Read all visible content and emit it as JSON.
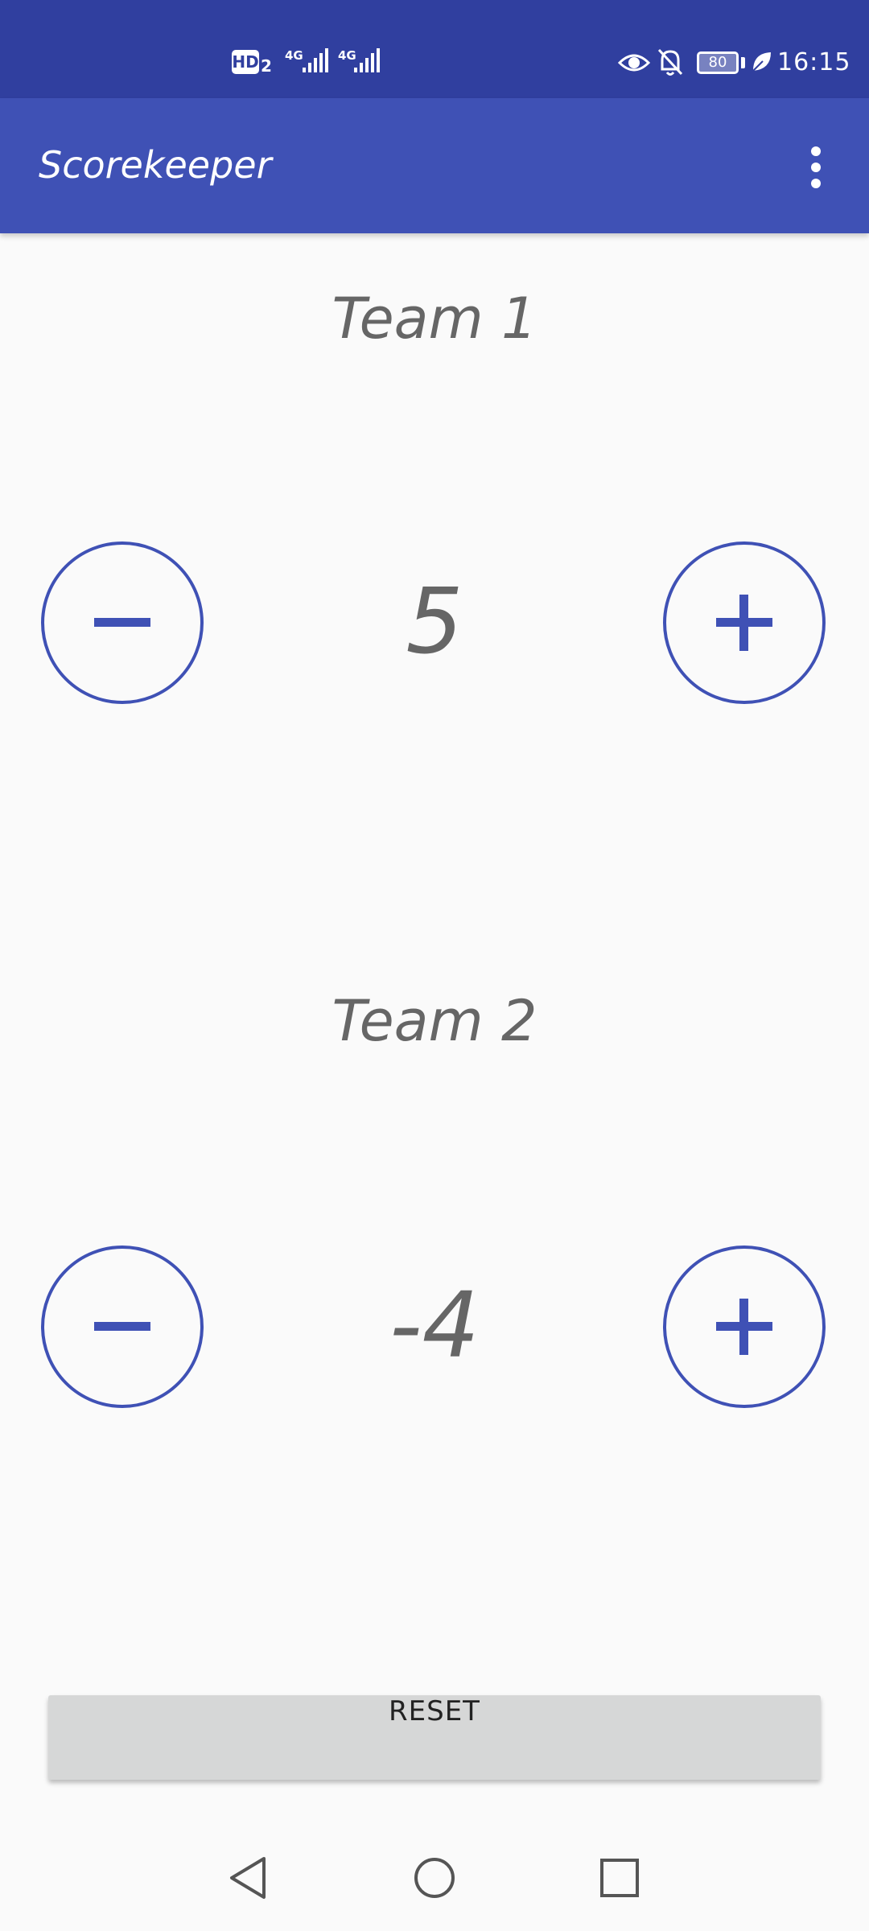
{
  "status_bar": {
    "hd_label": "HD",
    "hd_sim": "2",
    "network1": "4G",
    "network2": "4G",
    "battery_level": "80",
    "time": "16:15",
    "icons": [
      "signal-icon",
      "eye-icon",
      "bell-off-icon",
      "battery-icon",
      "leaf-icon"
    ]
  },
  "app_bar": {
    "title": "Scorekeeper",
    "menu_icon": "overflow-menu-icon"
  },
  "teams": [
    {
      "name": "Team 1",
      "score": "5",
      "decrease_icon": "minus-icon",
      "increase_icon": "plus-icon"
    },
    {
      "name": "Team 2",
      "score": "-4",
      "decrease_icon": "minus-icon",
      "increase_icon": "plus-icon"
    }
  ],
  "reset_label": "RESET",
  "nav_bar": {
    "icons": [
      "back-icon",
      "home-icon",
      "recents-icon"
    ]
  },
  "colors": {
    "status_bar": "#303f9f",
    "app_bar": "#3f51b5",
    "accent": "#3f51b5",
    "text": "#666666",
    "background": "#fafafa",
    "reset_button": "#d6d7d7"
  }
}
